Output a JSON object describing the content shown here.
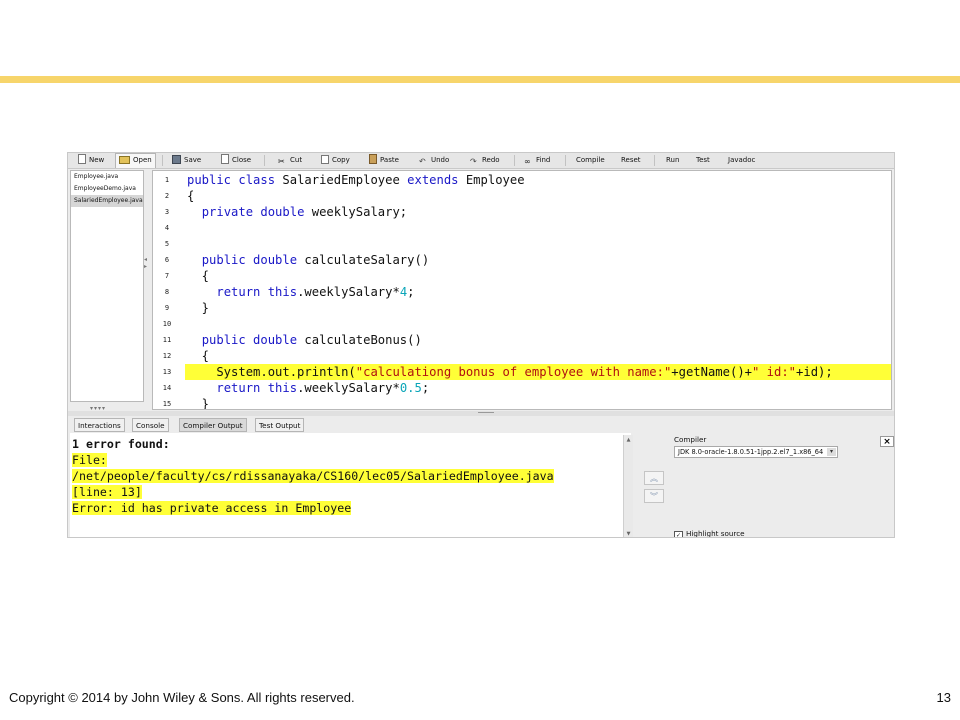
{
  "slide": {
    "footer": "Copyright © 2014 by John Wiley & Sons.  All rights reserved.",
    "page_number": "13",
    "accent_color": "#f7d56b"
  },
  "toolbar": {
    "new": "New",
    "open": "Open",
    "save": "Save",
    "close": "Close",
    "cut": "Cut",
    "copy": "Copy",
    "paste": "Paste",
    "undo": "Undo",
    "redo": "Redo",
    "find": "Find",
    "compile": "Compile",
    "reset": "Reset",
    "run": "Run",
    "test": "Test",
    "javadoc": "Javadoc"
  },
  "files": [
    "Employee.java",
    "EmployeeDemo.java",
    "SalariedEmployee.java"
  ],
  "editor": {
    "line_numbers": [
      "1",
      "2",
      "3",
      "4",
      "5",
      "6",
      "7",
      "8",
      "9",
      "10",
      "11",
      "12",
      "13",
      "14",
      "15"
    ],
    "highlighted_line": "13",
    "highlight_color": "#ffff37"
  },
  "tabs": {
    "interactions": "Interactions",
    "console": "Console",
    "compiler_output": "Compiler Output",
    "test_output": "Test Output"
  },
  "output": {
    "line1": "1 error found:",
    "line2": "File:",
    "line3": "/net/people/faculty/cs/rdissanayaka/CS160/lec05/SalariedEmployee.java",
    "line4": "[line: 13]",
    "line5": "Error: id has private access in Employee"
  },
  "compiler_panel": {
    "label": "Compiler",
    "selected": "JDK 8.0-oracle-1.8.0.51-1jpp.2.el7_1.x86_64",
    "highlight_source": "Highlight source"
  }
}
